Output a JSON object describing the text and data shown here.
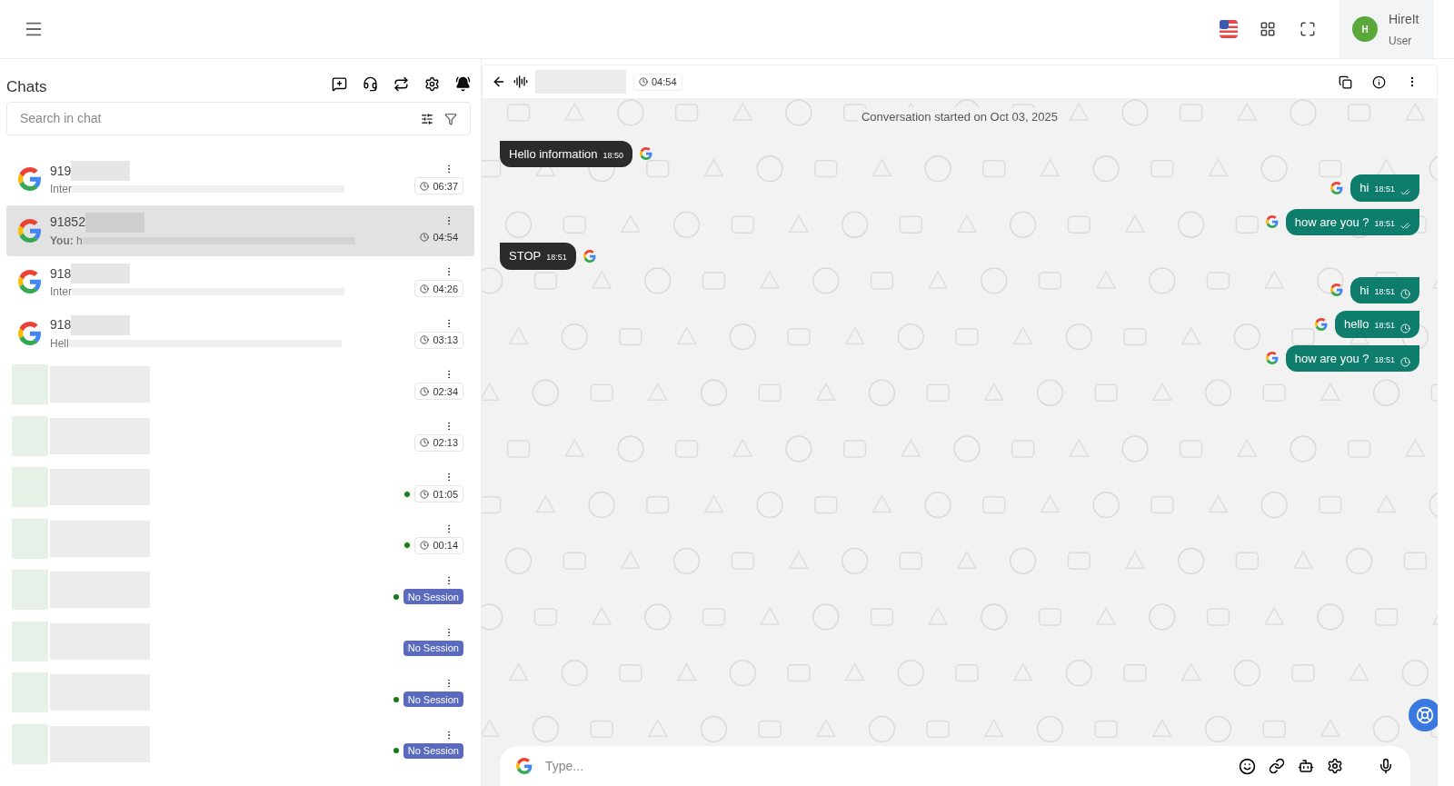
{
  "header": {
    "user": {
      "initial": "H",
      "name": "HireIt",
      "role": "User"
    }
  },
  "chats": {
    "title": "Chats",
    "search": {
      "placeholder": "Search in chat"
    },
    "items": [
      {
        "name": "919",
        "preview": "Inter",
        "selected": false,
        "online": false,
        "status": {
          "kind": "time",
          "text": "06:37"
        }
      },
      {
        "name": "91852",
        "preview": "**You:** h",
        "selected": true,
        "online": false,
        "status": {
          "kind": "time",
          "text": "04:54"
        }
      },
      {
        "name": "918",
        "preview": "Inter",
        "selected": false,
        "online": false,
        "status": {
          "kind": "time",
          "text": "04:26"
        }
      },
      {
        "name": "918",
        "preview": "Hell",
        "selected": false,
        "online": false,
        "status": {
          "kind": "time",
          "text": "03:13"
        }
      },
      {
        "selected": false,
        "online": false,
        "status": {
          "kind": "time",
          "text": "02:34"
        }
      },
      {
        "selected": false,
        "online": false,
        "status": {
          "kind": "time",
          "text": "02:13"
        }
      },
      {
        "selected": false,
        "online": true,
        "status": {
          "kind": "time",
          "text": "01:05"
        }
      },
      {
        "selected": false,
        "online": true,
        "status": {
          "kind": "time",
          "text": "00:14"
        }
      },
      {
        "selected": false,
        "online": true,
        "status": {
          "kind": "badge",
          "text": "No Session"
        }
      },
      {
        "selected": false,
        "online": false,
        "status": {
          "kind": "badge",
          "text": "No Session"
        }
      },
      {
        "selected": false,
        "online": true,
        "status": {
          "kind": "badge",
          "text": "No Session"
        }
      },
      {
        "selected": false,
        "online": true,
        "status": {
          "kind": "badge",
          "text": "No Session"
        }
      }
    ]
  },
  "conversation": {
    "time": "04:54",
    "started": "Conversation started on Oct 03, 2025",
    "messages": [
      {
        "kind": "incoming",
        "text": "Hello information",
        "time": "18:50"
      },
      {
        "kind": "outgoing",
        "text": "hi",
        "time": "18:51",
        "read": true
      },
      {
        "kind": "outgoing",
        "text": "how are you ?",
        "time": "18:51",
        "read": true
      },
      {
        "kind": "incoming",
        "text": "STOP",
        "time": "18:51"
      },
      {
        "kind": "outgoing",
        "text": "hi",
        "time": "18:51",
        "read": false
      },
      {
        "kind": "outgoing",
        "text": "hello",
        "time": "18:51",
        "read": false
      },
      {
        "kind": "outgoing",
        "text": "how are you ?",
        "time": "18:51",
        "read": false
      }
    ],
    "composer": {
      "placeholder": "Type..."
    }
  }
}
